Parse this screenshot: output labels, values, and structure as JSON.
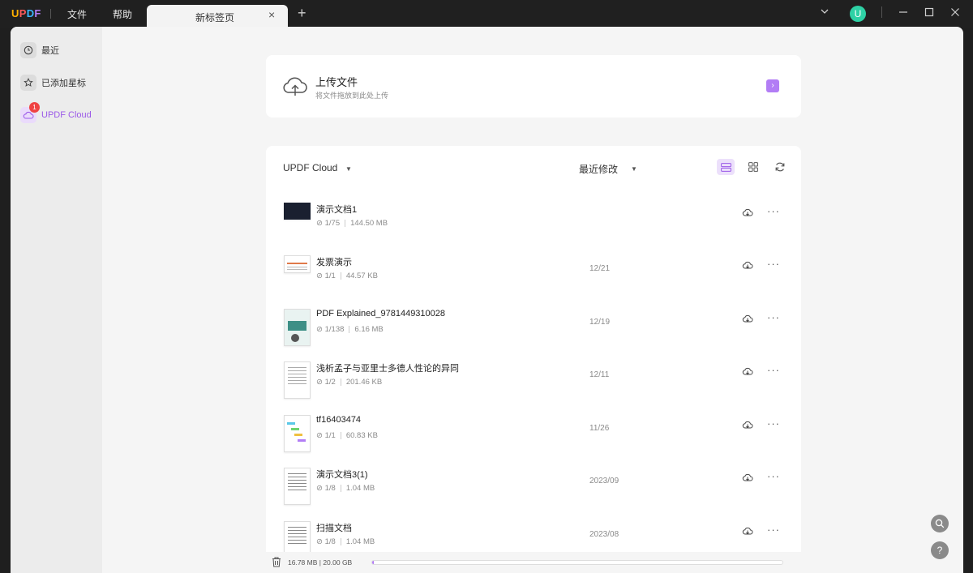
{
  "titlebar": {
    "logo": "UPDF",
    "menu": [
      "文件",
      "帮助"
    ],
    "tab_label": "新标签页",
    "tab_close": "×",
    "tab_add": "+",
    "avatar_letter": "U",
    "chevron": "⌵",
    "minimize": "—",
    "maximize": "☐",
    "close": "✕"
  },
  "sidebar": {
    "items": [
      {
        "label": "最近",
        "icon": "clock-icon"
      },
      {
        "label": "已添加星标",
        "icon": "star-icon"
      },
      {
        "label": "UPDF Cloud",
        "icon": "cloud-icon",
        "badge": "1"
      }
    ]
  },
  "upload": {
    "title": "上传文件",
    "subtitle": "将文件拖放到此处上传",
    "arrow": "›"
  },
  "panel": {
    "title": "UPDF Cloud",
    "sort_label": "最近修改",
    "files": [
      {
        "name": "演示文档1",
        "pages": "1/75",
        "size": "144.50 MB",
        "date": ""
      },
      {
        "name": "发票演示",
        "pages": "1/1",
        "size": "44.57 KB",
        "date": "12/21"
      },
      {
        "name": "PDF Explained_9781449310028",
        "pages": "1/138",
        "size": "6.16 MB",
        "date": "12/19"
      },
      {
        "name": "浅析孟子与亚里士多德人性论的异同",
        "pages": "1/2",
        "size": "201.46 KB",
        "date": "12/11"
      },
      {
        "name": "tf16403474",
        "pages": "1/1",
        "size": "60.83 KB",
        "date": "11/26"
      },
      {
        "name": "演示文档3(1)",
        "pages": "1/8",
        "size": "1.04 MB",
        "date": "2023/09"
      },
      {
        "name": "扫描文档",
        "pages": "1/8",
        "size": "1.04 MB",
        "date": "2023/08"
      }
    ]
  },
  "footer": {
    "storage": "16.78 MB | 20.00 GB",
    "storage_fraction": 0.0008
  },
  "colors": {
    "accent": "#b27df5",
    "badge": "#ef4343",
    "avatar": "#2ed1a5"
  }
}
